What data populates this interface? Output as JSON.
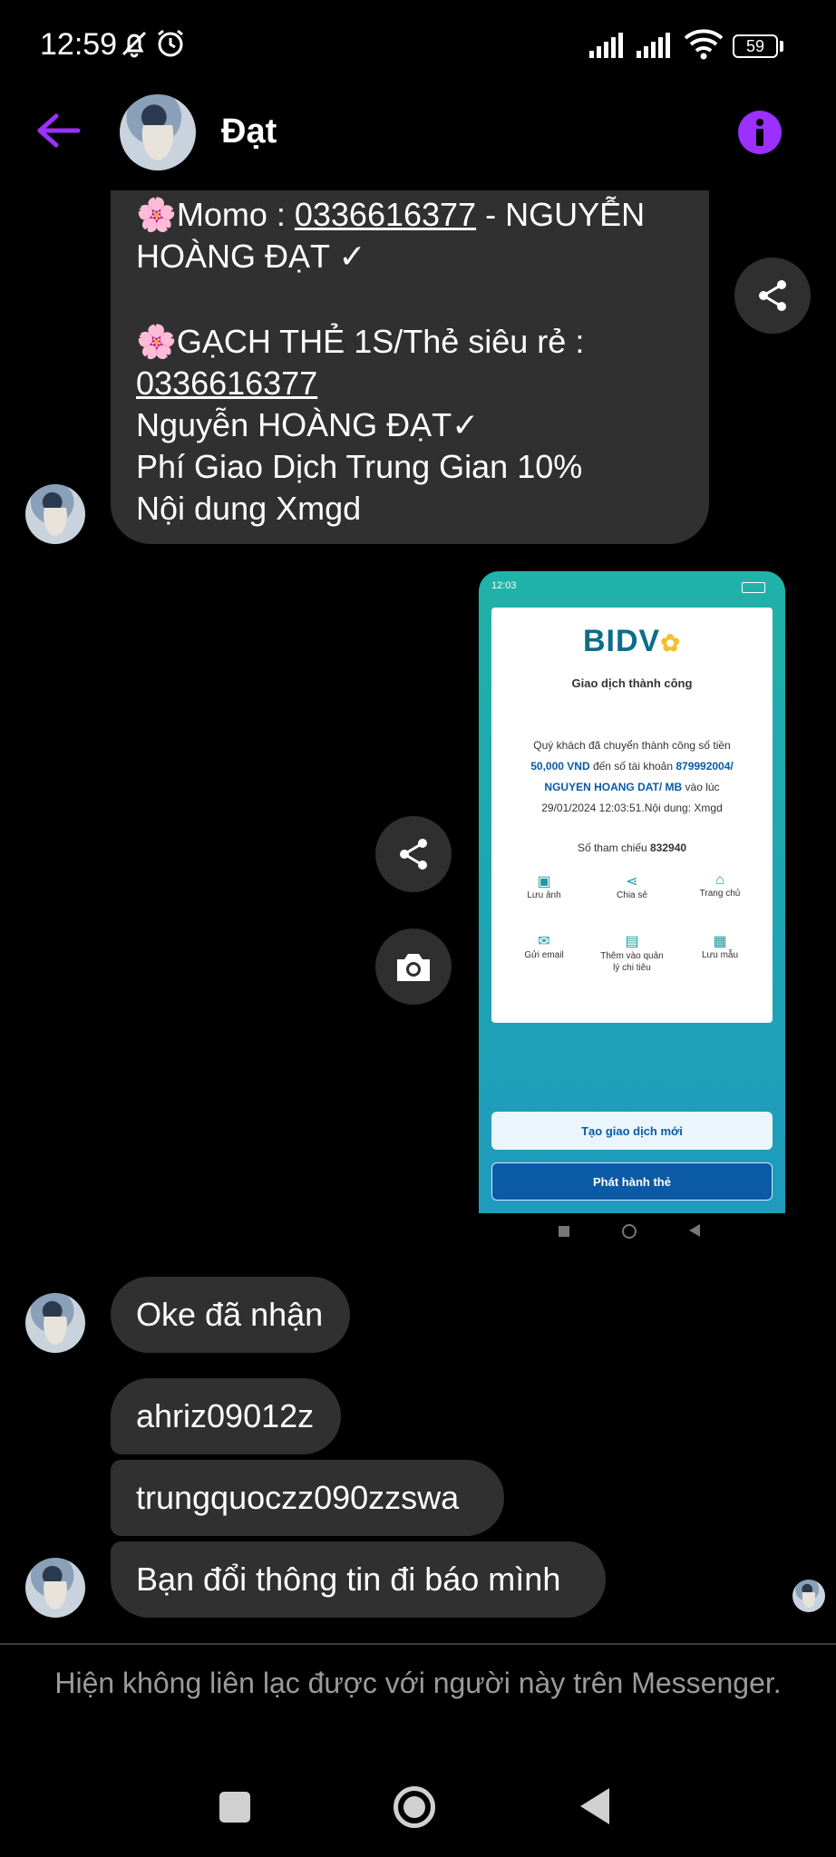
{
  "status_bar": {
    "time": "12:59",
    "battery": "59"
  },
  "header": {
    "contact_name": "Đạt"
  },
  "messages": {
    "info_block": {
      "line1_prefix": "🌸Momo : ",
      "line1_phone": "0336616377",
      "line1_suffix": " - NGUYỄN",
      "line2": "HOÀNG ĐẠT ✓",
      "line3": "🌸GẠCH THẺ 1S/Thẻ siêu rẻ  :",
      "line4": "0336616377",
      "line5": "Nguyễn HOÀNG ĐẠT✓",
      "line6": "Phí Giao Dịch Trung Gian 10%",
      "line7": "Nội dung Xmgd"
    },
    "m1": "Oke đã nhận",
    "m2": "ahriz09012z",
    "m3": "trungquoczz090zzswa",
    "m4": "Bạn đổi thông tin đi báo mình"
  },
  "receipt": {
    "mini_time": "12:03",
    "brand": "BIDV",
    "title": "Giao dịch thành công",
    "line1": "Quý khách đã chuyển thành công số tiền",
    "line2_amount": "50,000 VND",
    "line2_mid": " đến số tài khoản ",
    "line2_acct": "879992004/",
    "line3_name": "NGUYEN HOANG DAT/ MB",
    "line3_suffix": " vào lúc",
    "line4": "29/01/2024 12:03:51.Nội dung: Xmgd",
    "ref_label": "Số tham chiếu ",
    "ref_value": "832940",
    "actions": [
      "Lưu ảnh",
      "Chia sẻ",
      "Trang chủ",
      "Gửi email",
      "Thêm vào quản lý chi tiêu",
      "Lưu mẫu"
    ],
    "btn_new": "Tạo giao dịch mới",
    "btn_issue": "Phát hành thẻ"
  },
  "footer": {
    "notice": "Hiện không liên lạc được với người này trên Messenger."
  },
  "colors": {
    "accent": "#9b30ff",
    "bubble": "#303030",
    "bidv_blue": "#0b5aa6",
    "bidv_teal": "#1fb0a8"
  }
}
